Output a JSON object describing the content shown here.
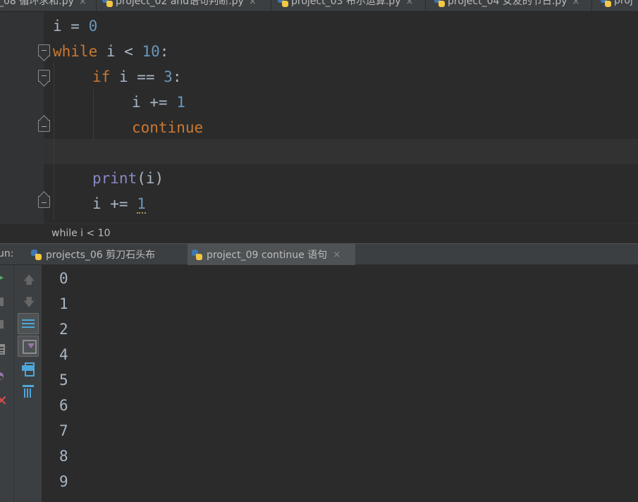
{
  "editor_tabs": [
    {
      "label": "_08 循环求和.py"
    },
    {
      "label": "project_02 and语句判断.py"
    },
    {
      "label": "project_03 布尔运算.py"
    },
    {
      "label": "project_04 女友的节日.py"
    },
    {
      "label": "proj"
    }
  ],
  "tab_close": "×",
  "code": {
    "l1_var": "i",
    "l1_op": " = ",
    "l1_num": "0",
    "l2_kw": "while",
    "l2_mid": " i < ",
    "l2_num": "10",
    "l2_end": ":",
    "l3_kw": "if",
    "l3_mid": " i == ",
    "l3_num": "3",
    "l3_end": ":",
    "l4_mid": "i += ",
    "l4_num": "1",
    "l5_kw": "continue",
    "l7_fn": "print",
    "l7_rest": "(i)",
    "l8_mid": "i += ",
    "l8_num": "1"
  },
  "breadcrumb": "while i < 10",
  "run": {
    "label": "un:",
    "tabs": [
      {
        "label": "projects_06 剪刀石头布"
      },
      {
        "label": "project_09 continue 语句"
      }
    ]
  },
  "toolbar": {
    "up_arrow": "🡅",
    "down_arrow": "🡇",
    "close_glyph": "✕"
  },
  "console_output": [
    "0",
    "1",
    "2",
    "4",
    "5",
    "6",
    "7",
    "8",
    "9"
  ],
  "colors": {
    "keyword": "#cc7832",
    "number": "#6897bb",
    "builtin": "#8888c6",
    "text": "#a9b7c6",
    "background": "#2b2b2b"
  }
}
